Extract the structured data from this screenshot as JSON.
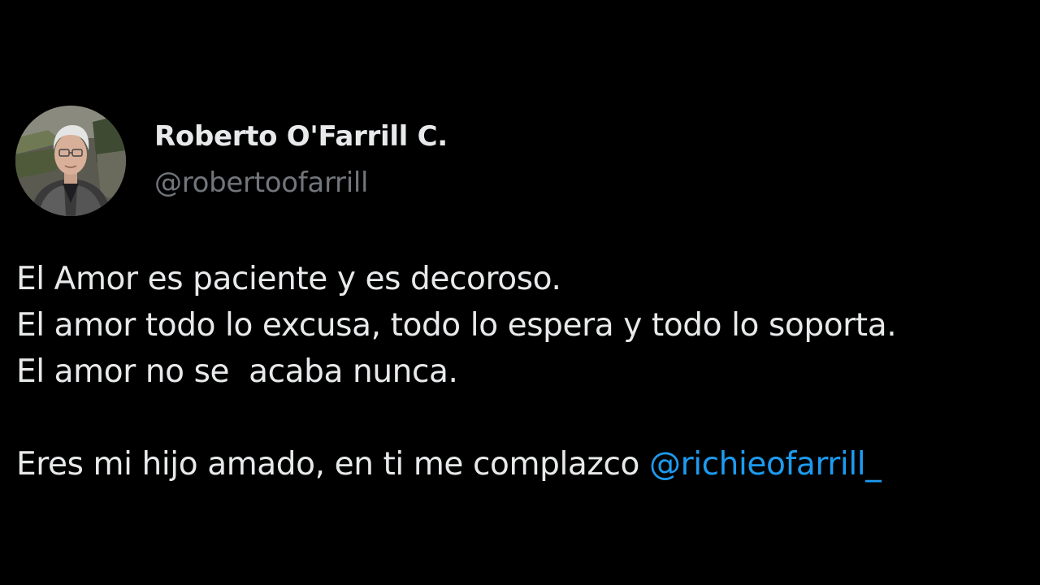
{
  "tweet": {
    "author": {
      "display_name": "Roberto O'Farrill C.",
      "handle": "@robertoofarrill",
      "avatar_icon": "profile-photo"
    },
    "lines": [
      "El Amor es paciente y es decoroso.",
      "El amor todo lo excusa, todo lo espera y todo lo soporta.",
      "El amor no se  acaba nunca."
    ],
    "closing_text": "Eres mi hijo amado, en ti me complazco ",
    "mention": "@richieofarrill_"
  },
  "colors": {
    "background": "#000000",
    "primary_text": "#e7e9ea",
    "secondary_text": "#71767b",
    "mention": "#1d9bf0"
  }
}
